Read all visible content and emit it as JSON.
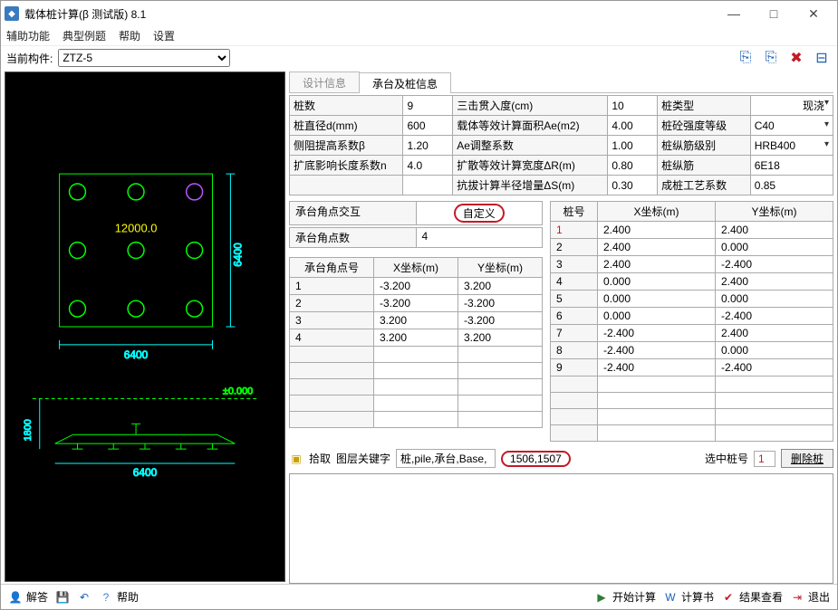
{
  "window": {
    "title": "载体桩计算(β 测试版) 8.1"
  },
  "menu": [
    "辅助功能",
    "典型例题",
    "帮助",
    "设置"
  ],
  "toolbar": {
    "current_label": "当前构件:",
    "current_value": "ZTZ-5"
  },
  "tabs": {
    "t1": "设计信息",
    "t2": "承台及桩信息"
  },
  "props": {
    "r1c1": "桩数",
    "r1v1": "9",
    "r1c2": "三击贯入度(cm)",
    "r1v2": "10",
    "r1c3": "桩类型",
    "r1v3": "现浇",
    "r2c1": "桩直径d(mm)",
    "r2v1": "600",
    "r2c2": "载体等效计算面积Ae(m2)",
    "r2v2": "4.00",
    "r2c3": "桩砼强度等级",
    "r2v3": "C40",
    "r3c1": "侧阻提高系数β",
    "r3v1": "1.20",
    "r3c2": "Ae调整系数",
    "r3v2": "1.00",
    "r3c3": "桩纵筋级别",
    "r3v3": "HRB400",
    "r4c1": "扩底影响长度系数n",
    "r4v1": "4.0",
    "r4c2": "扩散等效计算宽度ΔR(m)",
    "r4v2": "0.80",
    "r4c3": "桩纵筋",
    "r4v3": "6E18",
    "r5c2": "抗拔计算半径增量ΔS(m)",
    "r5v2": "0.30",
    "r5c3": "成桩工艺系数",
    "r5v3": "0.85"
  },
  "interact": {
    "label": "承台角点交互",
    "value": "自定义",
    "count_label": "承台角点数",
    "count_value": "4"
  },
  "cap_headers": {
    "idx": "承台角点号",
    "x": "X坐标(m)",
    "y": "Y坐标(m)"
  },
  "cap": [
    {
      "i": "1",
      "x": "-3.200",
      "y": "3.200"
    },
    {
      "i": "2",
      "x": "-3.200",
      "y": "-3.200"
    },
    {
      "i": "3",
      "x": "3.200",
      "y": "-3.200"
    },
    {
      "i": "4",
      "x": "3.200",
      "y": "3.200"
    }
  ],
  "pile_headers": {
    "idx": "桩号",
    "x": "X坐标(m)",
    "y": "Y坐标(m)"
  },
  "piles": [
    {
      "i": "1",
      "x": "2.400",
      "y": "2.400"
    },
    {
      "i": "2",
      "x": "2.400",
      "y": "0.000"
    },
    {
      "i": "3",
      "x": "2.400",
      "y": "-2.400"
    },
    {
      "i": "4",
      "x": "0.000",
      "y": "2.400"
    },
    {
      "i": "5",
      "x": "0.000",
      "y": "0.000"
    },
    {
      "i": "6",
      "x": "0.000",
      "y": "-2.400"
    },
    {
      "i": "7",
      "x": "-2.400",
      "y": "2.400"
    },
    {
      "i": "8",
      "x": "-2.400",
      "y": "0.000"
    },
    {
      "i": "9",
      "x": "-2.400",
      "y": "-2.400"
    }
  ],
  "pick": {
    "btn": "拾取",
    "kw_label": "图层关键字",
    "kw_value": "桩,pile,承台,Base,",
    "coord": "1506,1507",
    "sel_label": "选中桩号",
    "sel_value": "1",
    "del": "删除桩"
  },
  "status": {
    "answer": "解答",
    "help": "帮助",
    "calc": "开始计算",
    "book": "计算书",
    "result": "结果查看",
    "exit": "退出"
  },
  "cad": {
    "load": "12000.0",
    "dim1": "6400",
    "dim1v": "6400",
    "elev": "±0.000",
    "h": "1800",
    "dim2": "6400"
  }
}
